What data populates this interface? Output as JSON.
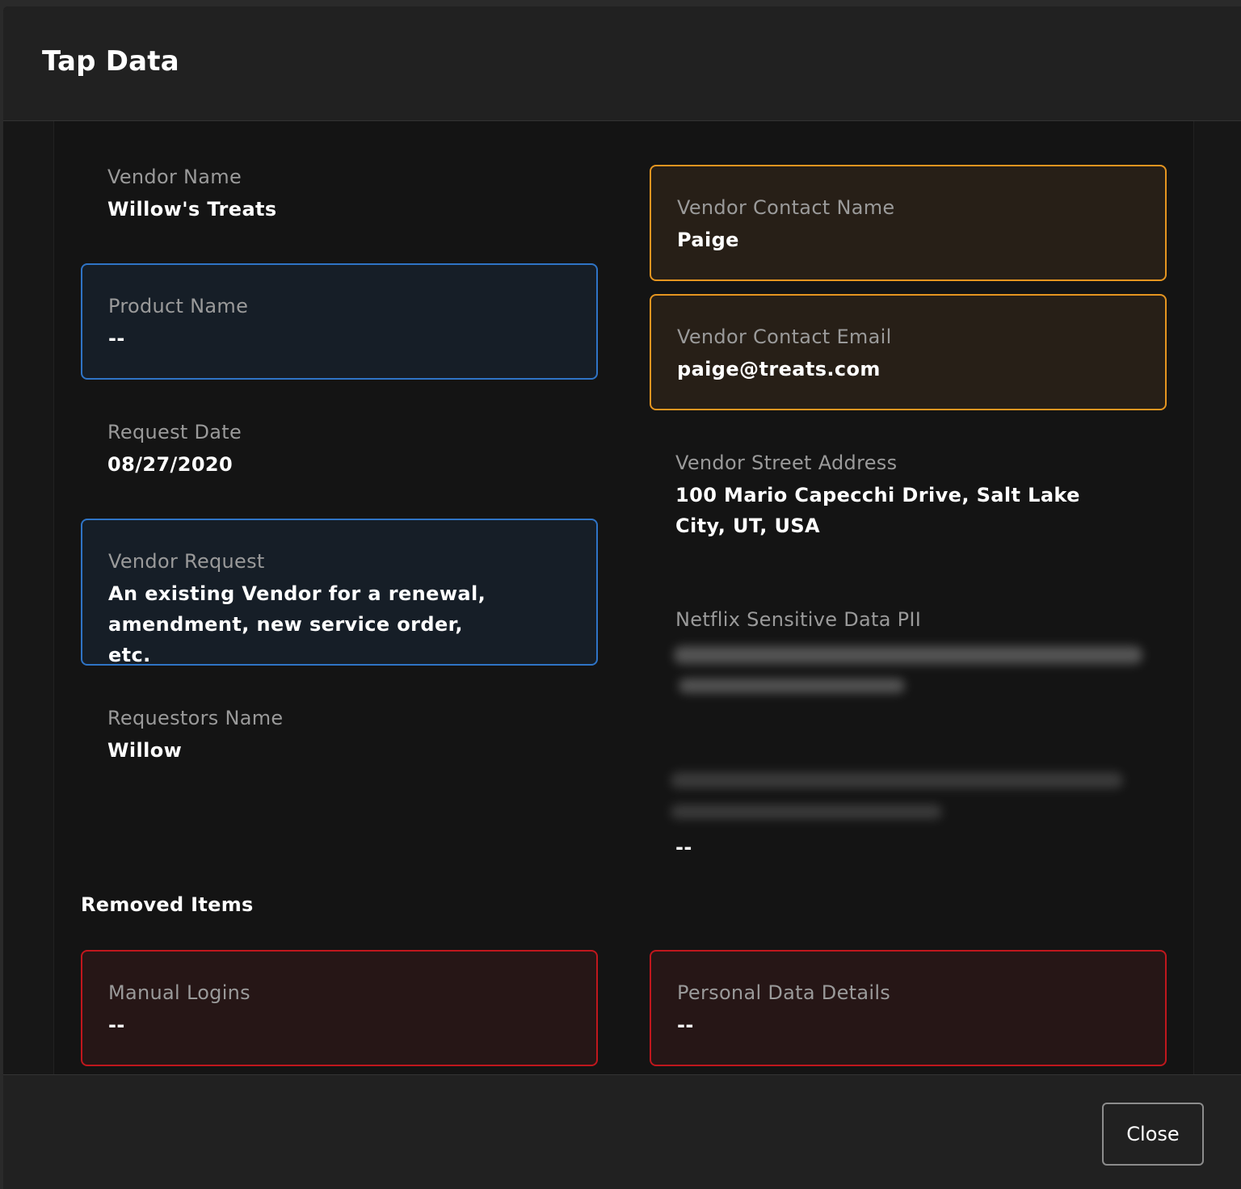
{
  "modal": {
    "title": "Tap Data",
    "close_label": "Close"
  },
  "fields": {
    "vendor_name": {
      "label": "Vendor Name",
      "value": "Willow's Treats"
    },
    "product_name": {
      "label": "Product Name",
      "value": "--"
    },
    "request_date": {
      "label": "Request Date",
      "value": "08/27/2020"
    },
    "vendor_request": {
      "label": "Vendor Request",
      "value": "An existing Vendor for a renewal, amendment, new service order, etc."
    },
    "requestors_name": {
      "label": "Requestors Name",
      "value": "Willow"
    },
    "vendor_contact_name": {
      "label": "Vendor Contact Name",
      "value": "Paige"
    },
    "vendor_contact_email": {
      "label": "Vendor Contact Email",
      "value": "paige@treats.com"
    },
    "vendor_street_address": {
      "label": "Vendor Street Address",
      "value": "100 Mario Capecchi Drive, Salt Lake City, UT, USA"
    },
    "netflix_sensitive_data": {
      "label": "Netflix Sensitive Data PII",
      "value": "--"
    }
  },
  "removed_items": {
    "title": "Removed Items",
    "manual_logins": {
      "label": "Manual Logins",
      "value": "--"
    },
    "personal_data_details": {
      "label": "Personal Data Details",
      "value": "--"
    }
  },
  "colors": {
    "highlight_blue": "#2f74c6",
    "highlight_orange": "#e59520",
    "highlight_red": "#c0171d"
  }
}
